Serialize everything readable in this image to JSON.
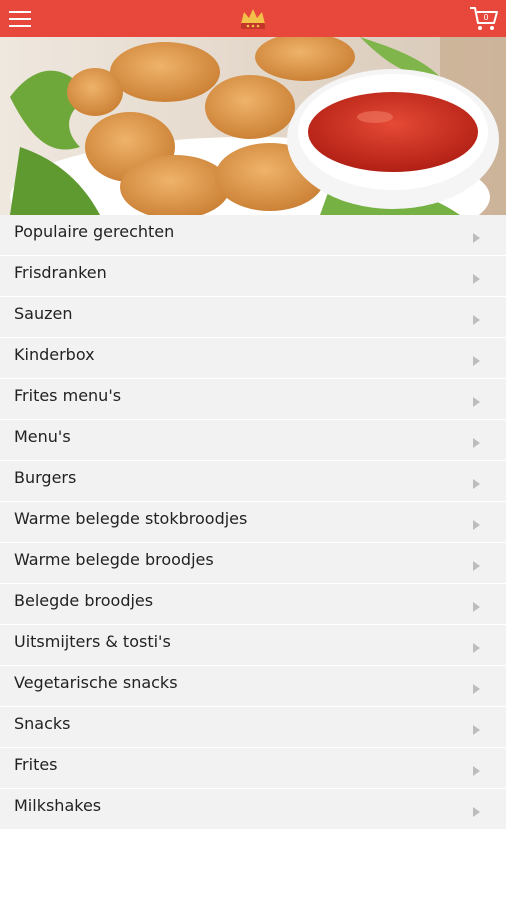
{
  "colors": {
    "header": "#e8473c",
    "list_bg": "#f2f2f2",
    "arrow": "#bdbdbd"
  },
  "header": {
    "menu_icon": "hamburger-menu-icon",
    "logo": "restaurant-logo",
    "cart_icon": "shopping-cart-icon",
    "cart_count": "0"
  },
  "hero": {
    "description_icon": "hero-image"
  },
  "categories": [
    {
      "label": "Populaire gerechten"
    },
    {
      "label": "Frisdranken"
    },
    {
      "label": "Sauzen"
    },
    {
      "label": "Kinderbox"
    },
    {
      "label": "Frites menu's"
    },
    {
      "label": "Menu's"
    },
    {
      "label": "Burgers"
    },
    {
      "label": "Warme belegde stokbroodjes"
    },
    {
      "label": "Warme belegde broodjes"
    },
    {
      "label": "Belegde broodjes"
    },
    {
      "label": "Uitsmijters & tosti's"
    },
    {
      "label": "Vegetarische snacks"
    },
    {
      "label": "Snacks"
    },
    {
      "label": "Frites"
    },
    {
      "label": "Milkshakes"
    }
  ]
}
